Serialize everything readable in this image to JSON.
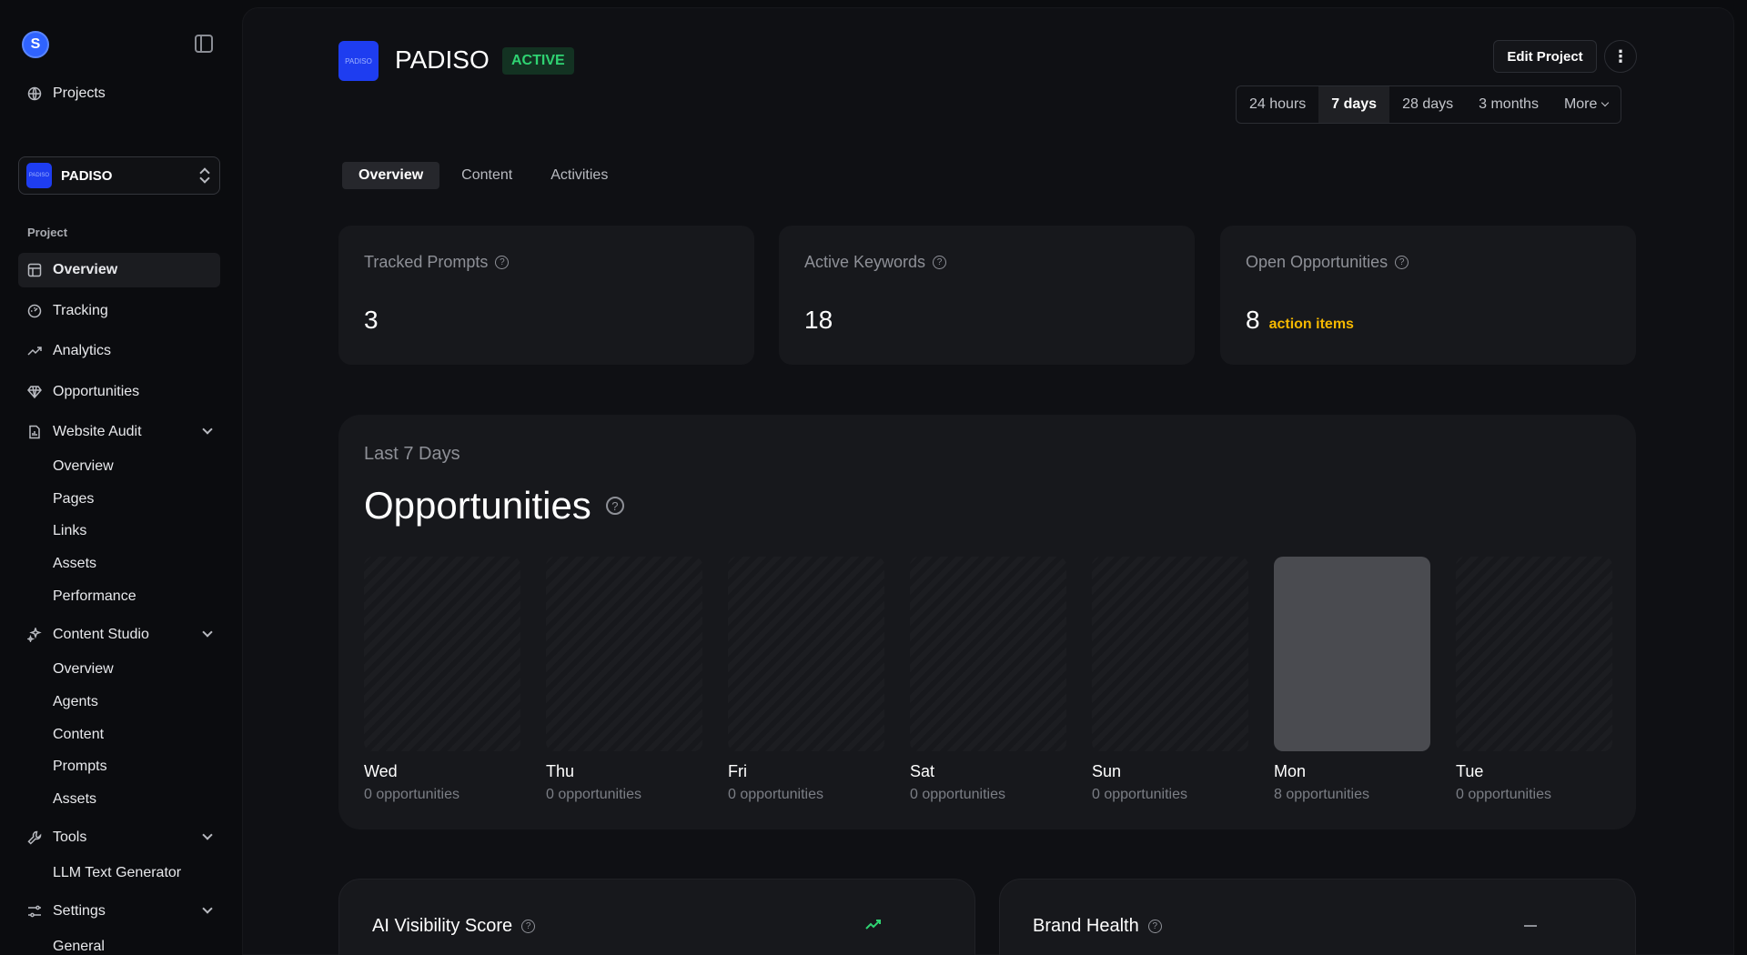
{
  "sidebar": {
    "logo_letter": "S",
    "projects_label": "Projects",
    "project_select": {
      "thumb": "PADISO",
      "name": "PADISO"
    },
    "section_label": "Project",
    "items": [
      {
        "label": "Overview",
        "icon": "layout-icon"
      },
      {
        "label": "Tracking",
        "icon": "tracking-icon"
      },
      {
        "label": "Analytics",
        "icon": "trend-icon"
      },
      {
        "label": "Opportunities",
        "icon": "gem-icon"
      },
      {
        "label": "Website Audit",
        "icon": "file-chart-icon"
      },
      {
        "label": "Content Studio",
        "icon": "sparkles-icon"
      },
      {
        "label": "Tools",
        "icon": "wrench-icon"
      },
      {
        "label": "Settings",
        "icon": "sliders-icon"
      }
    ],
    "website_audit_sub": [
      "Overview",
      "Pages",
      "Links",
      "Assets",
      "Performance"
    ],
    "content_studio_sub": [
      "Overview",
      "Agents",
      "Content",
      "Prompts",
      "Assets"
    ],
    "tools_sub": [
      "LLM Text Generator"
    ],
    "settings_sub": [
      "General"
    ]
  },
  "header": {
    "thumb": "PADISO",
    "title": "PADISO",
    "status": "ACTIVE",
    "edit_label": "Edit Project",
    "more_glyph": "⋮",
    "ranges": [
      "24 hours",
      "7 days",
      "28 days",
      "3 months",
      "More"
    ]
  },
  "tabs": [
    "Overview",
    "Content",
    "Activities"
  ],
  "stats": [
    {
      "label": "Tracked Prompts",
      "value": "3",
      "sub": ""
    },
    {
      "label": "Active Keywords",
      "value": "18",
      "sub": ""
    },
    {
      "label": "Open Opportunities",
      "value": "8",
      "sub": "action items"
    }
  ],
  "opportunities": {
    "period": "Last 7 Days",
    "title": "Opportunities",
    "days": [
      {
        "day": "Wed",
        "count_label": "0 opportunities",
        "count": 0
      },
      {
        "day": "Thu",
        "count_label": "0 opportunities",
        "count": 0
      },
      {
        "day": "Fri",
        "count_label": "0 opportunities",
        "count": 0
      },
      {
        "day": "Sat",
        "count_label": "0 opportunities",
        "count": 0
      },
      {
        "day": "Sun",
        "count_label": "0 opportunities",
        "count": 0
      },
      {
        "day": "Mon",
        "count_label": "8 opportunities",
        "count": 8
      },
      {
        "day": "Tue",
        "count_label": "0 opportunities",
        "count": 0
      }
    ]
  },
  "bottom_cards": [
    {
      "title": "AI Visibility Score",
      "indicator": "trend-up-icon"
    },
    {
      "title": "Brand Health",
      "indicator": "dash-icon"
    }
  ],
  "help_glyph": "?",
  "colors": {
    "accent": "#1e3df0",
    "active_green": "#2fd372",
    "warning": "#f5b800",
    "trend_green": "#2fd372"
  }
}
